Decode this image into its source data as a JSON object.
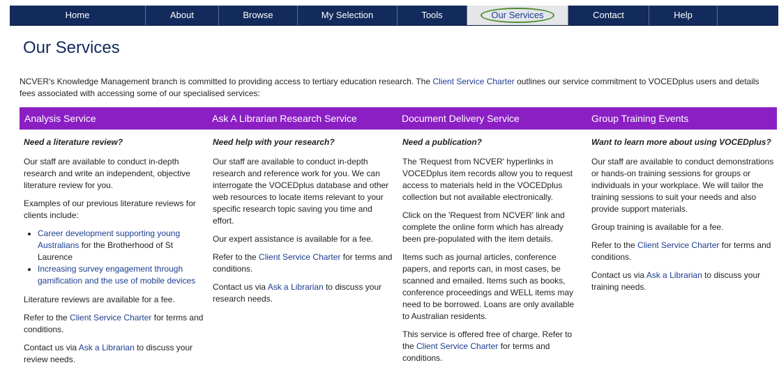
{
  "nav": {
    "items": [
      "Home",
      "About",
      "Browse",
      "My Selection",
      "Tools",
      "Our Services",
      "Contact",
      "Help"
    ],
    "active": "Our Services"
  },
  "page_title": "Our Services",
  "intro": {
    "before": "NCVER's Knowledge Management branch is committed to providing access to tertiary education research. The ",
    "link": "Client Service Charter",
    "after": " outlines our service commitment to VOCEDplus users and details fees associated with accessing some of our specialised services:"
  },
  "columns": [
    {
      "heading": "Analysis Service",
      "question": "Need a literature review?",
      "p1": "Our staff are available to conduct in-depth research and write an independent, objective literature review for you.",
      "p2": "Examples of our  previous literature reviews for clients include:",
      "bullets": [
        {
          "link": "Career development supporting young Australians",
          "after": " for the Brotherhood of St Laurence"
        },
        {
          "link": "Increasing survey engagement through gamification and the use of mobile devices",
          "after": ""
        }
      ],
      "fee": "Literature reviews are available for a fee.",
      "refer_before": "Refer to the ",
      "refer_link": "Client Service Charter",
      "refer_after": " for terms and conditions.",
      "contact_before": "Contact us via ",
      "contact_link": "Ask a Librarian",
      "contact_after": " to discuss your review needs."
    },
    {
      "heading": "Ask A Librarian Research Service",
      "question": "Need help with your research?",
      "p1": "Our staff are available to conduct in-depth research and reference work for you. We can interrogate the VOCEDplus database and other web resources to locate items relevant to your specific research topic saving you time and effort.",
      "fee": "Our expert assistance is available for a fee.",
      "refer_before": "Refer to the ",
      "refer_link": "Client Service Charter",
      "refer_after": " for terms and conditions.",
      "contact_before": "Contact us via ",
      "contact_link": "Ask a Librarian",
      "contact_after": " to discuss your research needs."
    },
    {
      "heading": "Document Delivery Service",
      "question": "Need a publication?",
      "p1": "The 'Request from NCVER' hyperlinks in VOCEDplus item records allow you to request access to materials held in the VOCEDplus collection but not available electronically.",
      "p2": "Click on the 'Request from NCVER' link and complete the online form which has already been pre-populated with the item details.",
      "p3": "Items such as journal articles, conference papers, and reports can, in most cases, be scanned and emailed. Items such as books, conference proceedings and WELL items may need to be borrowed. Loans are only available to Australian residents.",
      "refer_before": "This service is offered free of charge. Refer to the ",
      "refer_link": "Client Service Charter",
      "refer_after": " for terms and conditions."
    },
    {
      "heading": "Group Training Events",
      "question": "Want to learn more about using VOCEDplus?",
      "p1": "Our staff are available to conduct demonstrations or hands-on training sessions for groups or individuals in your workplace. We will tailor the training sessions to suit your needs and also provide support materials.",
      "fee": "Group training is available for a fee.",
      "refer_before": "Refer to the ",
      "refer_link": "Client Service Charter",
      "refer_after": " for terms and conditions.",
      "contact_before": "Contact us via ",
      "contact_link": "Ask a Librarian",
      "contact_after": " to discuss your training needs."
    }
  ],
  "colors": {
    "nav_background": "#122a5c",
    "band_purple": "#8b1fc4",
    "link_blue": "#1d3d8f",
    "active_ring_green": "#4f8a2a"
  }
}
